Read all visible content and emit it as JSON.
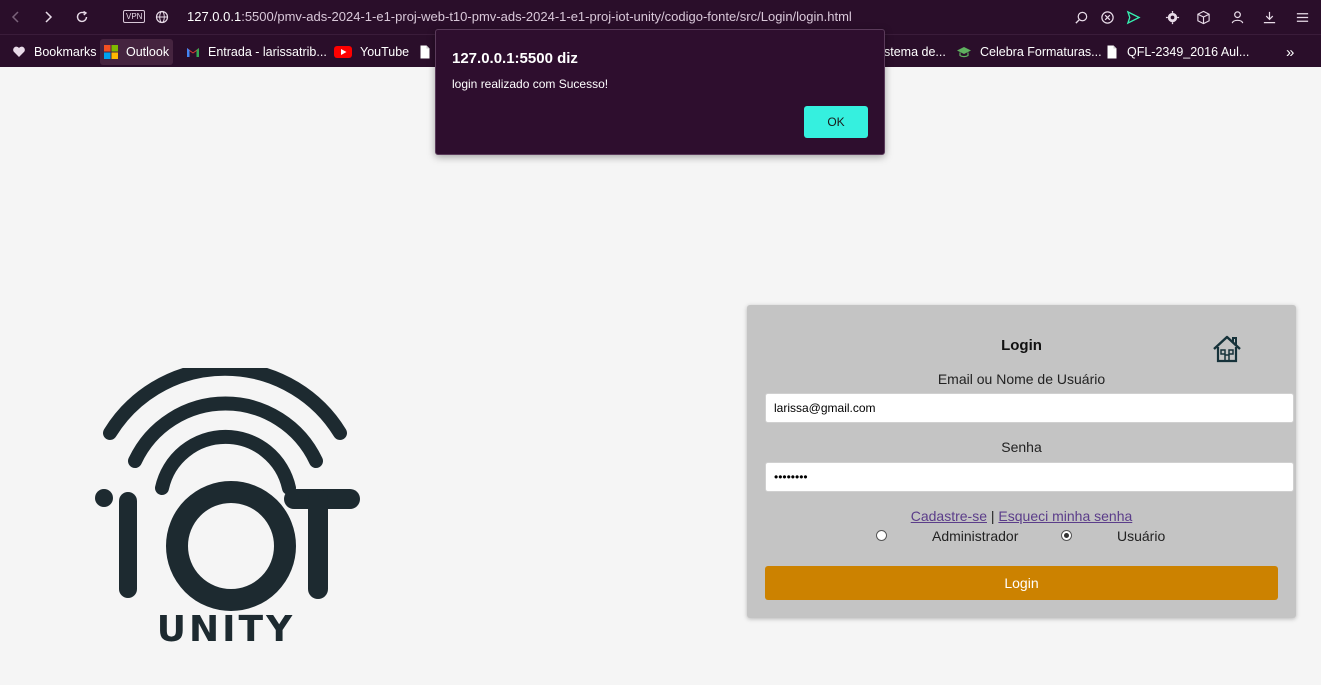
{
  "browser": {
    "url_host": "127.0.0.1",
    "url_rest": ":5500/pmv-ads-2024-1-e1-proj-web-t10-pmv-ads-2024-1-e1-proj-iot-unity/codigo-fonte/src/Login/login.html",
    "vpn_label": "VPN",
    "bookmarks": [
      {
        "label": "Bookmarks",
        "icon": "heart-icon"
      },
      {
        "label": "Outlook",
        "icon": "microsoft-icon"
      },
      {
        "label": "Entrada - larissatrib...",
        "icon": "gmail-icon"
      },
      {
        "label": "YouTube",
        "icon": "youtube-icon"
      },
      {
        "label": "",
        "icon": "file-icon"
      },
      {
        "label": "stema de...",
        "icon": ""
      },
      {
        "label": "Celebra Formaturas...",
        "icon": "graduation-cap-icon"
      },
      {
        "label": "QFL-2349_2016 Aul...",
        "icon": "file-icon"
      }
    ],
    "more_bookmarks": "»"
  },
  "dialog": {
    "title": "127.0.0.1:5500 diz",
    "message": "login realizado com Sucesso!",
    "ok_label": "OK"
  },
  "logo": {
    "wordmark": "IOT",
    "subtitle": "UNITY"
  },
  "login": {
    "title": "Login",
    "user_label": "Email ou Nome de Usuário",
    "user_value": "larissa@gmail.com",
    "password_label": "Senha",
    "password_value": "••••••••",
    "register_link": "Cadastre-se",
    "separator": "|",
    "forgot_link": "Esqueci minha senha",
    "role_admin": "Administrador",
    "role_user": "Usuário",
    "selected_role": "Usuário",
    "submit_label": "Login"
  },
  "colors": {
    "chrome": "#2a0e2a",
    "dialog_ok": "#35f0df",
    "login_button": "#cc8200",
    "card": "#c4c4c4",
    "logo": "#1d2a30"
  }
}
